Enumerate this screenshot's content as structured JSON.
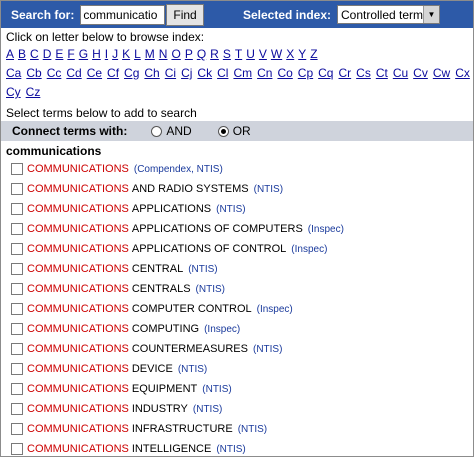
{
  "search": {
    "label": "Search for:",
    "value": "communicatio",
    "find_label": "Find",
    "index_label": "Selected index:",
    "index_value": "Controlled term"
  },
  "browse_hint": "Click on letter below to browse index:",
  "letters_row1": [
    "A",
    "B",
    "C",
    "D",
    "E",
    "F",
    "G",
    "H",
    "I",
    "J",
    "K",
    "L",
    "M",
    "N",
    "O",
    "P",
    "Q",
    "R",
    "S",
    "T",
    "U",
    "V",
    "W",
    "X",
    "Y",
    "Z"
  ],
  "letters_row2": [
    "Ca",
    "Cb",
    "Cc",
    "Cd",
    "Ce",
    "Cf",
    "Cg",
    "Ch",
    "Ci",
    "Cj",
    "Ck",
    "Cl",
    "Cm",
    "Cn",
    "Co",
    "Cp",
    "Cq",
    "Cr",
    "Cs",
    "Ct",
    "Cu",
    "Cv",
    "Cw",
    "Cx"
  ],
  "letters_row3": [
    "Cy",
    "Cz"
  ],
  "add_hint": "Select terms below to add to search",
  "connect": {
    "label": "Connect terms with:",
    "and_label": "AND",
    "or_label": "OR",
    "selected": "OR"
  },
  "term_heading": "communications",
  "terms": [
    {
      "base": "COMMUNICATIONS",
      "rest": "",
      "source": "(Compendex, NTIS)"
    },
    {
      "base": "COMMUNICATIONS",
      "rest": "AND RADIO SYSTEMS",
      "source": "(NTIS)"
    },
    {
      "base": "COMMUNICATIONS",
      "rest": "APPLICATIONS",
      "source": "(NTIS)"
    },
    {
      "base": "COMMUNICATIONS",
      "rest": "APPLICATIONS OF COMPUTERS",
      "source": "(Inspec)"
    },
    {
      "base": "COMMUNICATIONS",
      "rest": "APPLICATIONS OF CONTROL",
      "source": "(Inspec)"
    },
    {
      "base": "COMMUNICATIONS",
      "rest": "CENTRAL",
      "source": "(NTIS)"
    },
    {
      "base": "COMMUNICATIONS",
      "rest": "CENTRALS",
      "source": "(NTIS)"
    },
    {
      "base": "COMMUNICATIONS",
      "rest": "COMPUTER CONTROL",
      "source": "(Inspec)"
    },
    {
      "base": "COMMUNICATIONS",
      "rest": "COMPUTING",
      "source": "(Inspec)"
    },
    {
      "base": "COMMUNICATIONS",
      "rest": "COUNTERMEASURES",
      "source": "(NTIS)"
    },
    {
      "base": "COMMUNICATIONS",
      "rest": "DEVICE",
      "source": "(NTIS)"
    },
    {
      "base": "COMMUNICATIONS",
      "rest": "EQUIPMENT",
      "source": "(NTIS)"
    },
    {
      "base": "COMMUNICATIONS",
      "rest": "INDUSTRY",
      "source": "(NTIS)"
    },
    {
      "base": "COMMUNICATIONS",
      "rest": "INFRASTRUCTURE",
      "source": "(NTIS)"
    },
    {
      "base": "COMMUNICATIONS",
      "rest": "INTELLIGENCE",
      "source": "(NTIS)"
    }
  ],
  "colors": {
    "header_bg": "#2d5aa8",
    "term_base": "#cc0000",
    "source": "#1a3a9c",
    "link": "#0a0a9c",
    "connect_bg": "#cfd3dc"
  }
}
